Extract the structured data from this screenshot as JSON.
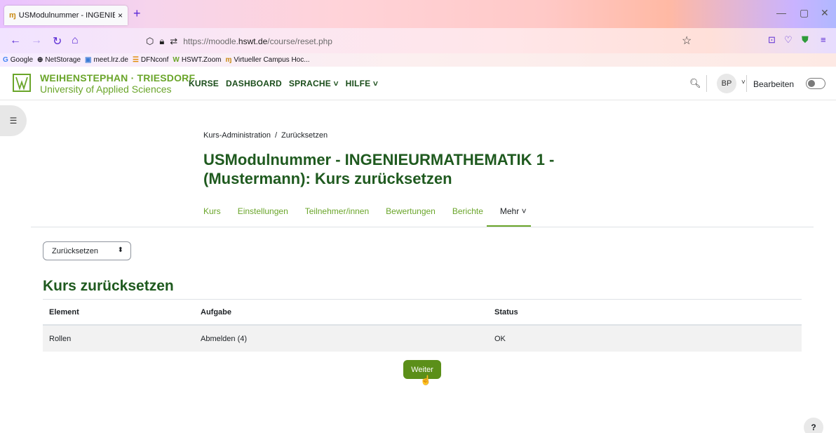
{
  "browser": {
    "tab_title": "USModulnummer - INGENIEUR",
    "tab_close": "×",
    "new_tab": "+",
    "url_plain": "https://moodle.",
    "url_domain": "hswt.de",
    "url_path": "/course/reset.php"
  },
  "bookmarks": [
    {
      "label": "Google",
      "icon": "google-icon"
    },
    {
      "label": "NetStorage",
      "icon": "globe-icon"
    },
    {
      "label": "meet.lrz.de",
      "icon": "meet-icon"
    },
    {
      "label": "DFNconf",
      "icon": "dfn-icon"
    },
    {
      "label": "HSWT.Zoom",
      "icon": "hswt-icon"
    },
    {
      "label": "Virtueller Campus Hoc...",
      "icon": "moodle-icon"
    }
  ],
  "site": {
    "logo_line1": "WEIHENSTEPHAN · TRIESDORF",
    "logo_line2": "University of Applied Sciences",
    "nav": [
      "KURSE",
      "DASHBOARD",
      "SPRACHE ˅",
      "HILFE ˅"
    ],
    "avatar_initials": "BP",
    "edit_mode_label": "Bearbeiten"
  },
  "page": {
    "breadcrumb": [
      "Kurs-Administration",
      "/",
      "Zurücksetzen"
    ],
    "title": "USModulnummer - INGENIEURMATHEMATIK 1 - (Mustermann): Kurs zurücksetzen",
    "secondary_nav": [
      "Kurs",
      "Einstellungen",
      "Teilnehmer/innen",
      "Bewertungen",
      "Berichte"
    ],
    "more_label": "Mehr ˅",
    "select_value": "Zurücksetzen",
    "heading": "Kurs zurücksetzen",
    "table": {
      "headers": [
        "Element",
        "Aufgabe",
        "Status"
      ],
      "rows": [
        [
          "Rollen",
          "Abmelden (4)",
          "OK"
        ]
      ]
    },
    "continue_button": "Weiter",
    "help": "?"
  },
  "colors": {
    "brand_green": "#6aa52a",
    "title_green": "#1f5a1f",
    "button_green": "#5b8f19"
  }
}
